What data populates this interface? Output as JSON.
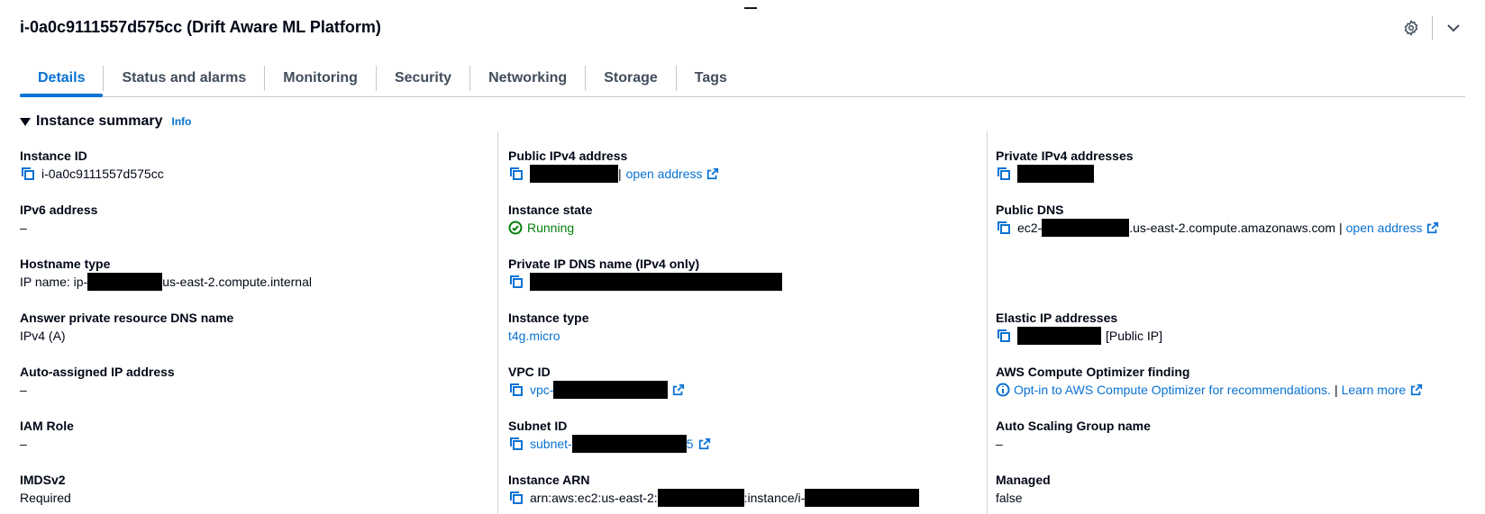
{
  "page": {
    "title": "i-0a0c9111557d575cc (Drift Aware ML Platform)"
  },
  "tabs": [
    {
      "label": "Details"
    },
    {
      "label": "Status and alarms"
    },
    {
      "label": "Monitoring"
    },
    {
      "label": "Security"
    },
    {
      "label": "Networking"
    },
    {
      "label": "Storage"
    },
    {
      "label": "Tags"
    }
  ],
  "section": {
    "title": "Instance summary",
    "info": "Info"
  },
  "col1": {
    "instance_id": {
      "label": "Instance ID",
      "value": "i-0a0c9111557d575cc"
    },
    "ipv6": {
      "label": "IPv6 address",
      "value": "–"
    },
    "hostname_type": {
      "label": "Hostname type",
      "prefix": "IP name: ip-",
      "suffix": "us-east-2.compute.internal"
    },
    "answer_dns": {
      "label": "Answer private resource DNS name",
      "value": "IPv4 (A)"
    },
    "auto_ip": {
      "label": "Auto-assigned IP address",
      "value": "–"
    },
    "iam_role": {
      "label": "IAM Role",
      "value": "–"
    },
    "imdsv2": {
      "label": "IMDSv2",
      "value": "Required"
    }
  },
  "col2": {
    "public_ipv4": {
      "label": "Public IPv4 address",
      "sep": "|",
      "open": "open address"
    },
    "state": {
      "label": "Instance state",
      "value": "Running"
    },
    "private_dns": {
      "label": "Private IP DNS name (IPv4 only)"
    },
    "instance_type": {
      "label": "Instance type",
      "value": "t4g.micro"
    },
    "vpc_id": {
      "label": "VPC ID",
      "prefix": "vpc-"
    },
    "subnet_id": {
      "label": "Subnet ID",
      "prefix": "subnet-",
      "suffix": "5"
    },
    "arn": {
      "label": "Instance ARN",
      "prefix": "arn:aws:ec2:us-east-2:",
      "middle": ":instance/i-"
    }
  },
  "col3": {
    "private_ipv4": {
      "label": "Private IPv4 addresses"
    },
    "public_dns": {
      "label": "Public DNS",
      "prefix": "ec2-",
      "suffix": ".us-east-2.compute.amazonaws.com",
      "sep": "|",
      "open": "open address"
    },
    "elastic_ip": {
      "label": "Elastic IP addresses",
      "suffix": "[Public IP]"
    },
    "optimizer": {
      "label": "AWS Compute Optimizer finding",
      "value": "Opt-in to AWS Compute Optimizer for recommendations.",
      "sep": "|",
      "learn": "Learn more"
    },
    "asg": {
      "label": "Auto Scaling Group name",
      "value": "–"
    },
    "managed": {
      "label": "Managed",
      "value": "false"
    }
  },
  "colors": {
    "accent": "#0972d3",
    "success": "#037f0c",
    "text": "#000716"
  }
}
